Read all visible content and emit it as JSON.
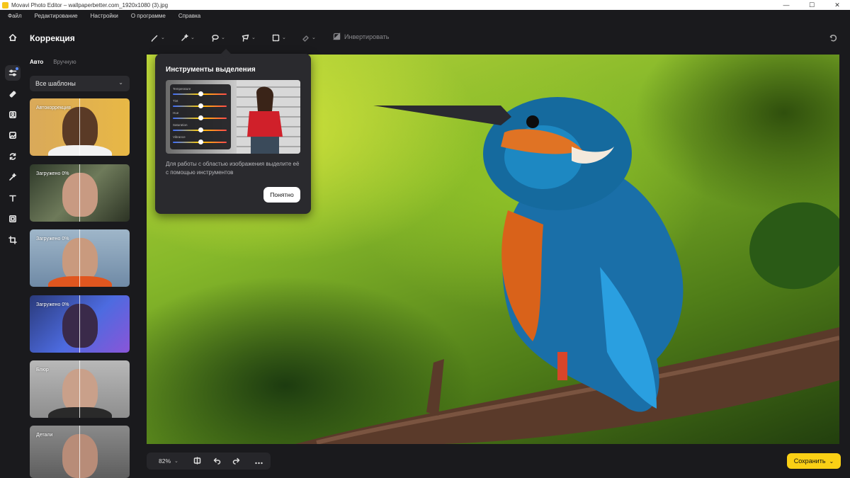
{
  "window": {
    "title": "Movavi Photo Editor – wallpaperbetter.com_1920x1080 (3).jpg",
    "min": "—",
    "max": "☐",
    "close": "✕"
  },
  "menu": [
    "Файл",
    "Редактирование",
    "Настройки",
    "О программе",
    "Справка"
  ],
  "panel": {
    "title": "Коррекция",
    "tabs": {
      "auto": "Авто",
      "manual": "Вручную"
    },
    "dropdown": "Все шаблоны",
    "presets": [
      {
        "label": "Автокоррекция"
      },
      {
        "label": "Загружено 0%"
      },
      {
        "label": "Загружено 0%"
      },
      {
        "label": "Загружено 0%"
      },
      {
        "label": "Блюр"
      },
      {
        "label": "Детали"
      }
    ]
  },
  "toolbar": {
    "invert": "Инвертировать"
  },
  "popup": {
    "title": "Инструменты выделения",
    "text": "Для работы с областью изображения выделите её с помощью инструментов",
    "button": "Понятно",
    "sliders": [
      "Temperature",
      "Tint",
      "Hue",
      "Saturation",
      "Vibrance"
    ]
  },
  "bottom": {
    "zoom": "82%"
  },
  "save": {
    "label": "Сохранить"
  },
  "colors": {
    "accent": "#fad015",
    "background": "#1a1a1d",
    "panel": "#2a2a2e"
  }
}
